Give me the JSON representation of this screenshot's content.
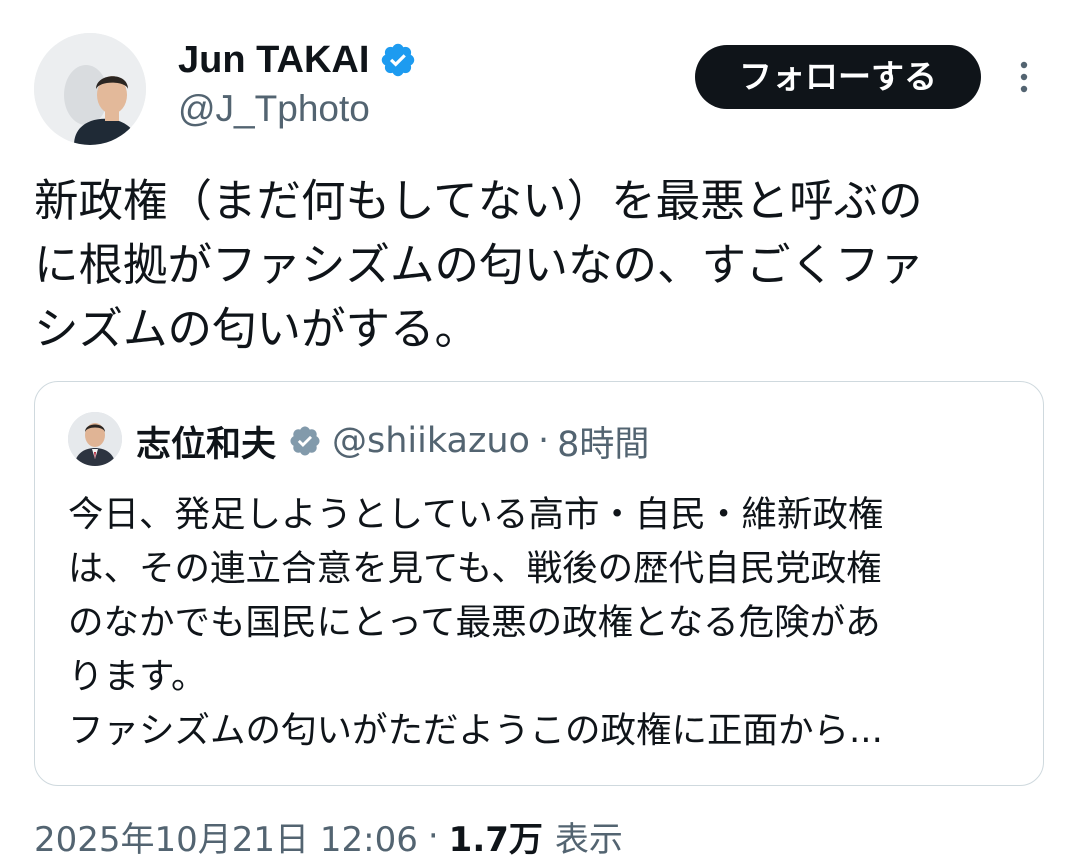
{
  "author": {
    "display_name": "Jun TAKAI",
    "handle": "@J_Tphoto",
    "verified_color": "#1d9bf0"
  },
  "actions": {
    "follow_label": "フォローする",
    "more_icon": "more-vertical-icon"
  },
  "tweet": {
    "text": "新政権（まだ何もしてない）を最悪と呼ぶの\nに根拠がファシズムの匂いなの、すごくファ\nシズムの匂いがする。"
  },
  "quote": {
    "display_name": "志位和夫",
    "handle": "@shiikazuo",
    "separator": "·",
    "time": "8時間",
    "verified_color": "#829aab",
    "text": "今日、発足しようとしている高市・自民・維新政権\nは、その連立合意を見ても、戦後の歴代自民党政権\nのなかでも国民にとって最悪の政権となる危険があ\nります。\nファシズムの匂いがただようこの政権に正面から..."
  },
  "meta": {
    "timestamp": "2025年10月21日 12:06",
    "separator": "·",
    "views_count": "1.7万",
    "views_label": "表示"
  }
}
